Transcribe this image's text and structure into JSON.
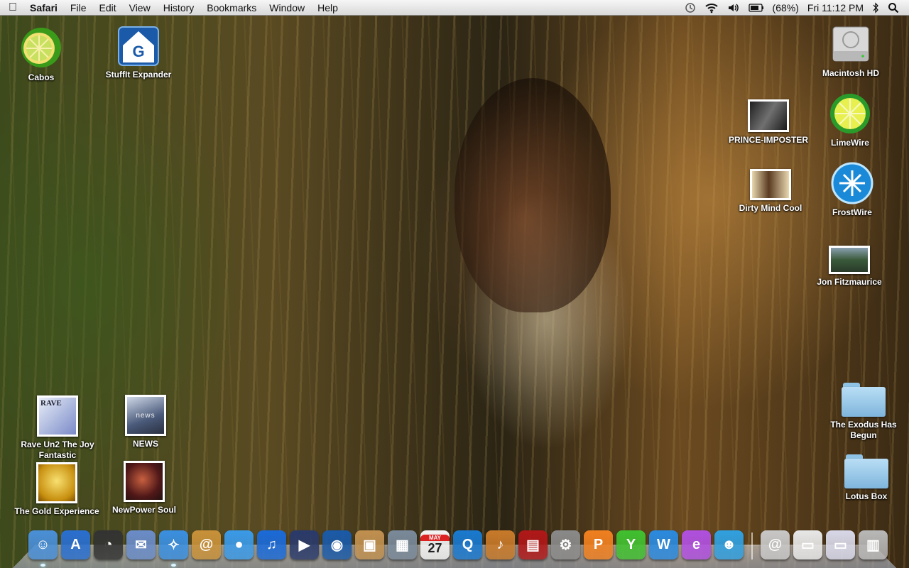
{
  "menubar": {
    "app_name": "Safari",
    "menus": [
      "File",
      "Edit",
      "View",
      "History",
      "Bookmarks",
      "Window",
      "Help"
    ],
    "battery_percent": "(68%)",
    "clock": "Fri 11:12 PM",
    "icons": [
      "apple-icon",
      "time-machine-icon",
      "wifi-icon",
      "volume-icon",
      "battery-icon",
      "bluetooth-icon",
      "spotlight-search-icon"
    ]
  },
  "desktop": {
    "icons_left": {
      "cabos": "Cabos",
      "stuffit": "StuffIt Expander",
      "rave": "Rave Un2 The Joy Fantastic",
      "news": "NEWS",
      "gold": "The Gold Experience",
      "newpower": "NewPower Soul"
    },
    "icons_right": {
      "macintosh_hd": "Macintosh HD",
      "prince_imposter": "PRINCE-IMPOSTER",
      "limewire": "LimeWire",
      "dirty_mind": "Dirty Mind Cool",
      "frostwire": "FrostWire",
      "jon": "Jon Fitzmaurice",
      "exodus": "The Exodus Has Begun",
      "lotus": "Lotus Box"
    },
    "thumb_text": {
      "rave": "RAVE",
      "news": "news"
    }
  },
  "dock": {
    "items": [
      {
        "name": "finder-icon",
        "color": "#4a8fd8"
      },
      {
        "name": "app-store-icon",
        "color": "#2a6fd0"
      },
      {
        "name": "dashboard-icon",
        "color": "#333333"
      },
      {
        "name": "mail-icon",
        "color": "#6a8cc8"
      },
      {
        "name": "safari-icon",
        "color": "#3a8fe0"
      },
      {
        "name": "address-book-icon",
        "color": "#c8913a"
      },
      {
        "name": "ichat-icon",
        "color": "#3a9ae8"
      },
      {
        "name": "itunes-icon",
        "color": "#1a6ad8"
      },
      {
        "name": "imovie-icon",
        "color": "#2a3a6a"
      },
      {
        "name": "idvd-icon",
        "color": "#1a5aa8"
      },
      {
        "name": "preview-icon",
        "color": "#c09050"
      },
      {
        "name": "iphoto-icon",
        "color": "#7a8a9a"
      },
      {
        "name": "ical-icon",
        "color": "#f4f4f4"
      },
      {
        "name": "quicktime-icon",
        "color": "#1a7ad0"
      },
      {
        "name": "garageband-icon",
        "color": "#c87a2a"
      },
      {
        "name": "photo-booth-icon",
        "color": "#b01818"
      },
      {
        "name": "system-preferences-icon",
        "color": "#8a8a8a"
      },
      {
        "name": "p-app-icon",
        "color": "#f08020"
      },
      {
        "name": "y-app-icon",
        "color": "#40c030"
      },
      {
        "name": "w-app-icon",
        "color": "#2a8ae0"
      },
      {
        "name": "e-app-icon",
        "color": "#b050e0"
      },
      {
        "name": "messenger-icon",
        "color": "#30a0e0"
      }
    ],
    "right_items": [
      {
        "name": "downloads-stack-icon",
        "color": "#c8c8c8"
      },
      {
        "name": "documents-stack-icon",
        "color": "#e8e8e8"
      },
      {
        "name": "screenshot-stack-icon",
        "color": "#d8d8e8"
      },
      {
        "name": "trash-icon",
        "color": "#b8b8b8"
      }
    ],
    "ical_day": "27",
    "ical_month": "MAY"
  }
}
